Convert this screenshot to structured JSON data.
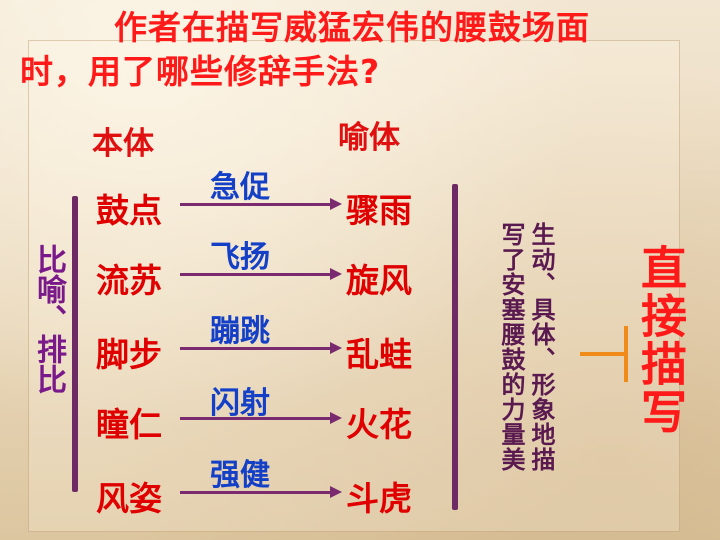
{
  "question": {
    "line1": "作者在描写威猛宏伟的腰鼓场面",
    "line2": "时，用了哪些修辞手法?"
  },
  "headers": {
    "tenor": "本体",
    "vehicle": "喻体"
  },
  "rows": [
    {
      "tenor": "鼓点",
      "verb": "急促",
      "vehicle": "骤雨"
    },
    {
      "tenor": "流苏",
      "verb": "飞扬",
      "vehicle": "旋风"
    },
    {
      "tenor": "脚步",
      "verb": "蹦跳",
      "vehicle": "乱蛙"
    },
    {
      "tenor": "瞳仁",
      "verb": "闪射",
      "vehicle": "火花"
    },
    {
      "tenor": "风姿",
      "verb": "强健",
      "vehicle": "斗虎"
    }
  ],
  "left_label": "比喻、排比",
  "summary": {
    "line1": "生动、具体、形象地描",
    "line2": "写了安塞腰鼓的力量美"
  },
  "conclusion": "直接描写",
  "colors": {
    "title": "#ff1a1a",
    "tenor_vehicle": "#e00000",
    "verb": "#1440c8",
    "rhetoric_label": "#7a1a8a",
    "summary": "#5a1a50",
    "conclusion": "#ff1a1a",
    "bracket": "#6e2a64",
    "connector": "#f08a18"
  }
}
